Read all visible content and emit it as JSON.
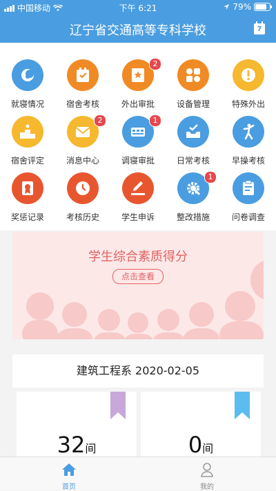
{
  "status": {
    "carrier": "中国移动",
    "time": "下午 6:21",
    "battery": "79%",
    "battery_level": 0.79
  },
  "nav": {
    "title": "辽宁省交通高等专科学校",
    "calendar_day": "7"
  },
  "colors": {
    "primary": "#4a9de0",
    "orange": "#f08a24",
    "yellow": "#f5b82e",
    "red": "#e8562f",
    "blue": "#4a9de0",
    "badge": "#e5484d"
  },
  "grid": [
    {
      "label": "就寝情况",
      "icon": "moon-icon",
      "color": "#4a9de0",
      "badge": null
    },
    {
      "label": "宿舍考核",
      "icon": "checklist-icon",
      "color": "#f08a24",
      "badge": null
    },
    {
      "label": "外出审批",
      "icon": "star-card-icon",
      "color": "#f08a24",
      "badge": "2"
    },
    {
      "label": "设备管理",
      "icon": "devices-icon",
      "color": "#f08a24",
      "badge": null
    },
    {
      "label": "特殊外出",
      "icon": "exclamation-icon",
      "color": "#f5b82e",
      "badge": null
    },
    {
      "label": "宿舍评定",
      "icon": "podium-icon",
      "color": "#f5b82e",
      "badge": null
    },
    {
      "label": "消息中心",
      "icon": "mail-icon",
      "color": "#f5b82e",
      "badge": "2"
    },
    {
      "label": "调寝审批",
      "icon": "beds-icon",
      "color": "#4a9de0",
      "badge": "1"
    },
    {
      "label": "日常考核",
      "icon": "inbox-check-icon",
      "color": "#4a9de0",
      "badge": null
    },
    {
      "label": "早操考核",
      "icon": "exercise-icon",
      "color": "#4a9de0",
      "badge": null
    },
    {
      "label": "奖惩记录",
      "icon": "certificate-icon",
      "color": "#e8562f",
      "badge": null
    },
    {
      "label": "考核历史",
      "icon": "clock-icon",
      "color": "#e8562f",
      "badge": null
    },
    {
      "label": "学生申诉",
      "icon": "pencil-icon",
      "color": "#e8562f",
      "badge": null
    },
    {
      "label": "整改措施",
      "icon": "gear-wrench-icon",
      "color": "#4a9de0",
      "badge": "1"
    },
    {
      "label": "问卷调查",
      "icon": "clipboard-icon",
      "color": "#4a9de0",
      "badge": null
    }
  ],
  "banner": {
    "title": "学生综合素质得分",
    "button": "点击查看"
  },
  "dept": {
    "label": "建筑工程系  2020-02-05"
  },
  "cards": [
    {
      "value": "32",
      "unit": "间",
      "ribbon_color": "#c7a8d8"
    },
    {
      "value": "0",
      "unit": "间",
      "ribbon_color": "#5bbcf0"
    }
  ],
  "tabs": [
    {
      "label": "首页",
      "icon": "home-icon",
      "active": true
    },
    {
      "label": "我的",
      "icon": "person-icon",
      "active": false
    }
  ]
}
